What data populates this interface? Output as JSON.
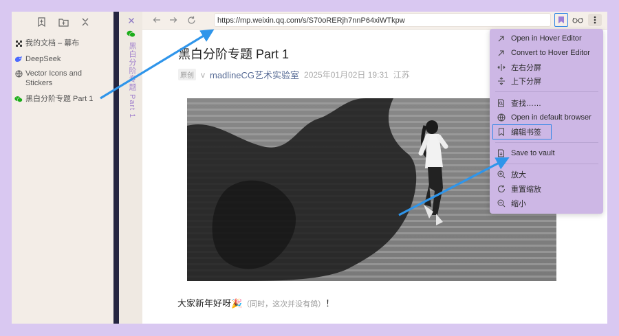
{
  "sidebar": {
    "tools": [
      {
        "name": "new-bookmark-icon"
      },
      {
        "name": "new-folder-icon"
      },
      {
        "name": "collapse-all-icon"
      }
    ],
    "items": [
      {
        "label": "我的文档 – 幕布",
        "icon": "mubu-icon"
      },
      {
        "label": "DeepSeek",
        "icon": "deepseek-icon"
      },
      {
        "label": "Vector Icons and Stickers",
        "icon": "globe-icon"
      },
      {
        "label": "黑白分阶专题 Part 1",
        "icon": "wechat-icon"
      }
    ]
  },
  "vertical_tab": {
    "label": "黑白分阶专题 Part 1"
  },
  "browser": {
    "url": "https://mp.weixin.qq.com/s/S70oRERjh7nnP64xiWTkpw"
  },
  "article": {
    "title": "黑白分阶专题 Part 1",
    "badge": "原创",
    "v": "v",
    "author": "madlineCG艺术实验室",
    "date": "2025年01月02日 19:31",
    "location": "江苏",
    "greeting": "大家新年好呀🎉",
    "greeting_note": "（同时，这次并没有鸽）",
    "greeting_end": "！"
  },
  "menu": {
    "items": [
      {
        "label": "Open in Hover Editor",
        "icon": "open-arrow-icon"
      },
      {
        "label": "Convert to Hover Editor",
        "icon": "convert-arrow-icon"
      },
      {
        "label": "左右分屏",
        "icon": "split-horizontal-icon"
      },
      {
        "label": "上下分屏",
        "icon": "split-vertical-icon"
      },
      {
        "label": "查找……",
        "icon": "search-doc-icon"
      },
      {
        "label": "Open in default browser",
        "icon": "globe-icon"
      },
      {
        "label": "编辑书签",
        "icon": "bookmark-icon"
      },
      {
        "label": "Save to vault",
        "icon": "save-file-icon"
      },
      {
        "label": "放大",
        "icon": "zoom-in-icon"
      },
      {
        "label": "重置缩放",
        "icon": "reset-zoom-icon"
      },
      {
        "label": "缩小",
        "icon": "zoom-out-icon"
      }
    ]
  },
  "colors": {
    "background": "#d9c8f1",
    "menu": "#cdb7e5",
    "accent_blue": "#2f86e6",
    "author_link": "#576b95",
    "tab_label": "#a383cd"
  }
}
